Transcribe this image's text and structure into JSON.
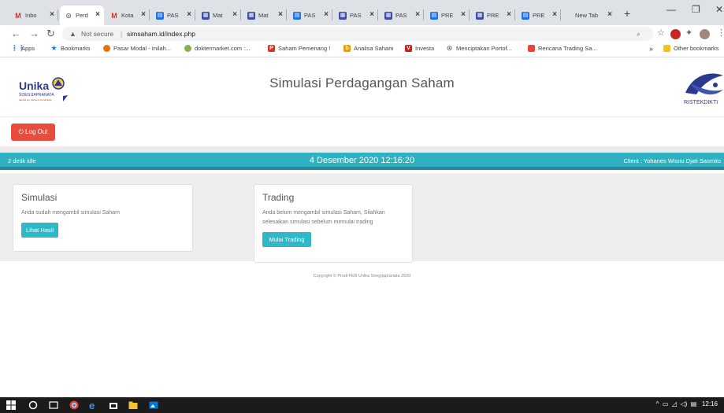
{
  "browser": {
    "tabs": [
      {
        "label": "Inbo",
        "icon": "gmail-icon",
        "active": false
      },
      {
        "label": "Perd",
        "icon": "globe-icon",
        "active": true
      },
      {
        "label": "Kota",
        "icon": "gmail-icon",
        "active": false
      },
      {
        "label": "PAS",
        "icon": "sheets-icon",
        "active": false
      },
      {
        "label": "Mat",
        "icon": "classroom-icon",
        "active": false
      },
      {
        "label": "Mat",
        "icon": "classroom-icon",
        "active": false
      },
      {
        "label": "PAS",
        "icon": "sheets-icon",
        "active": false
      },
      {
        "label": "PAS",
        "icon": "classroom-icon",
        "active": false
      },
      {
        "label": "PAS",
        "icon": "classroom-icon",
        "active": false
      },
      {
        "label": "PRE",
        "icon": "sheets-icon",
        "active": false
      },
      {
        "label": "PRE",
        "icon": "classroom-icon",
        "active": false
      },
      {
        "label": "PRE",
        "icon": "sheets-icon",
        "active": false
      },
      {
        "label": "New Tab",
        "icon": "",
        "active": false
      }
    ],
    "address": {
      "security": "Not secure",
      "separator": "|",
      "url": "simsaham.id/index.php"
    },
    "bookmarks": [
      {
        "label": "Apps",
        "icon": "apps-grid-icon",
        "color": "#1a73e8"
      },
      {
        "label": "Bookmarks",
        "icon": "star-icon",
        "color": "#1a73e8"
      },
      {
        "label": "Pasar Modal - Inilah...",
        "icon": "site-icon",
        "color": "#e8710a"
      },
      {
        "label": "doktermarket.com :...",
        "icon": "site-icon",
        "color": "#8ab04f"
      },
      {
        "label": "Saham Pemenang !",
        "icon": "site-icon",
        "color": "#d93025"
      },
      {
        "label": "Analisa Saham",
        "icon": "site-icon",
        "color": "#f29900"
      },
      {
        "label": "Investa",
        "icon": "site-icon",
        "color": "#c5221f"
      },
      {
        "label": "Menciptakan Portof...",
        "icon": "globe-icon",
        "color": "#5f6368"
      },
      {
        "label": "Rencana Trading Sa...",
        "icon": "site-icon",
        "color": "#e8453c"
      }
    ],
    "bookmarks_overflow": "»",
    "other_bookmarks": "Other bookmarks"
  },
  "site": {
    "logo_text": "Unika",
    "logo_sub": "SOEGIJAPRANATA",
    "title": "Simulasi Perdagangan Saham",
    "ristek_text": "RISTEKDIKTI",
    "logout_label": "Log Out"
  },
  "status": {
    "idle": "2 detik idle",
    "datetime": "4 Desember 2020 12:16:20",
    "client": "Client : Yohanes Wisnu Djati Sasmito"
  },
  "cards": {
    "simulasi": {
      "title": "Simulasi",
      "text": "Anda sudah mengambil simulasi Saham",
      "button": "Lihat Hasil"
    },
    "trading": {
      "title": "Trading",
      "text1": "Anda belum mengambil simulasi Saham, Silahkan",
      "text2": "selesaikan simulasi sebelum memulai trading",
      "button": "Mulai Trading"
    }
  },
  "footer": {
    "copyright": "Copyright © Prodi FEB Unika Soegijapranata 2020"
  },
  "taskbar": {
    "clock": "12:16"
  },
  "colors": {
    "accent": "#2fb1c1",
    "logout": "#e74c3c",
    "button": "#2fb8c7"
  }
}
